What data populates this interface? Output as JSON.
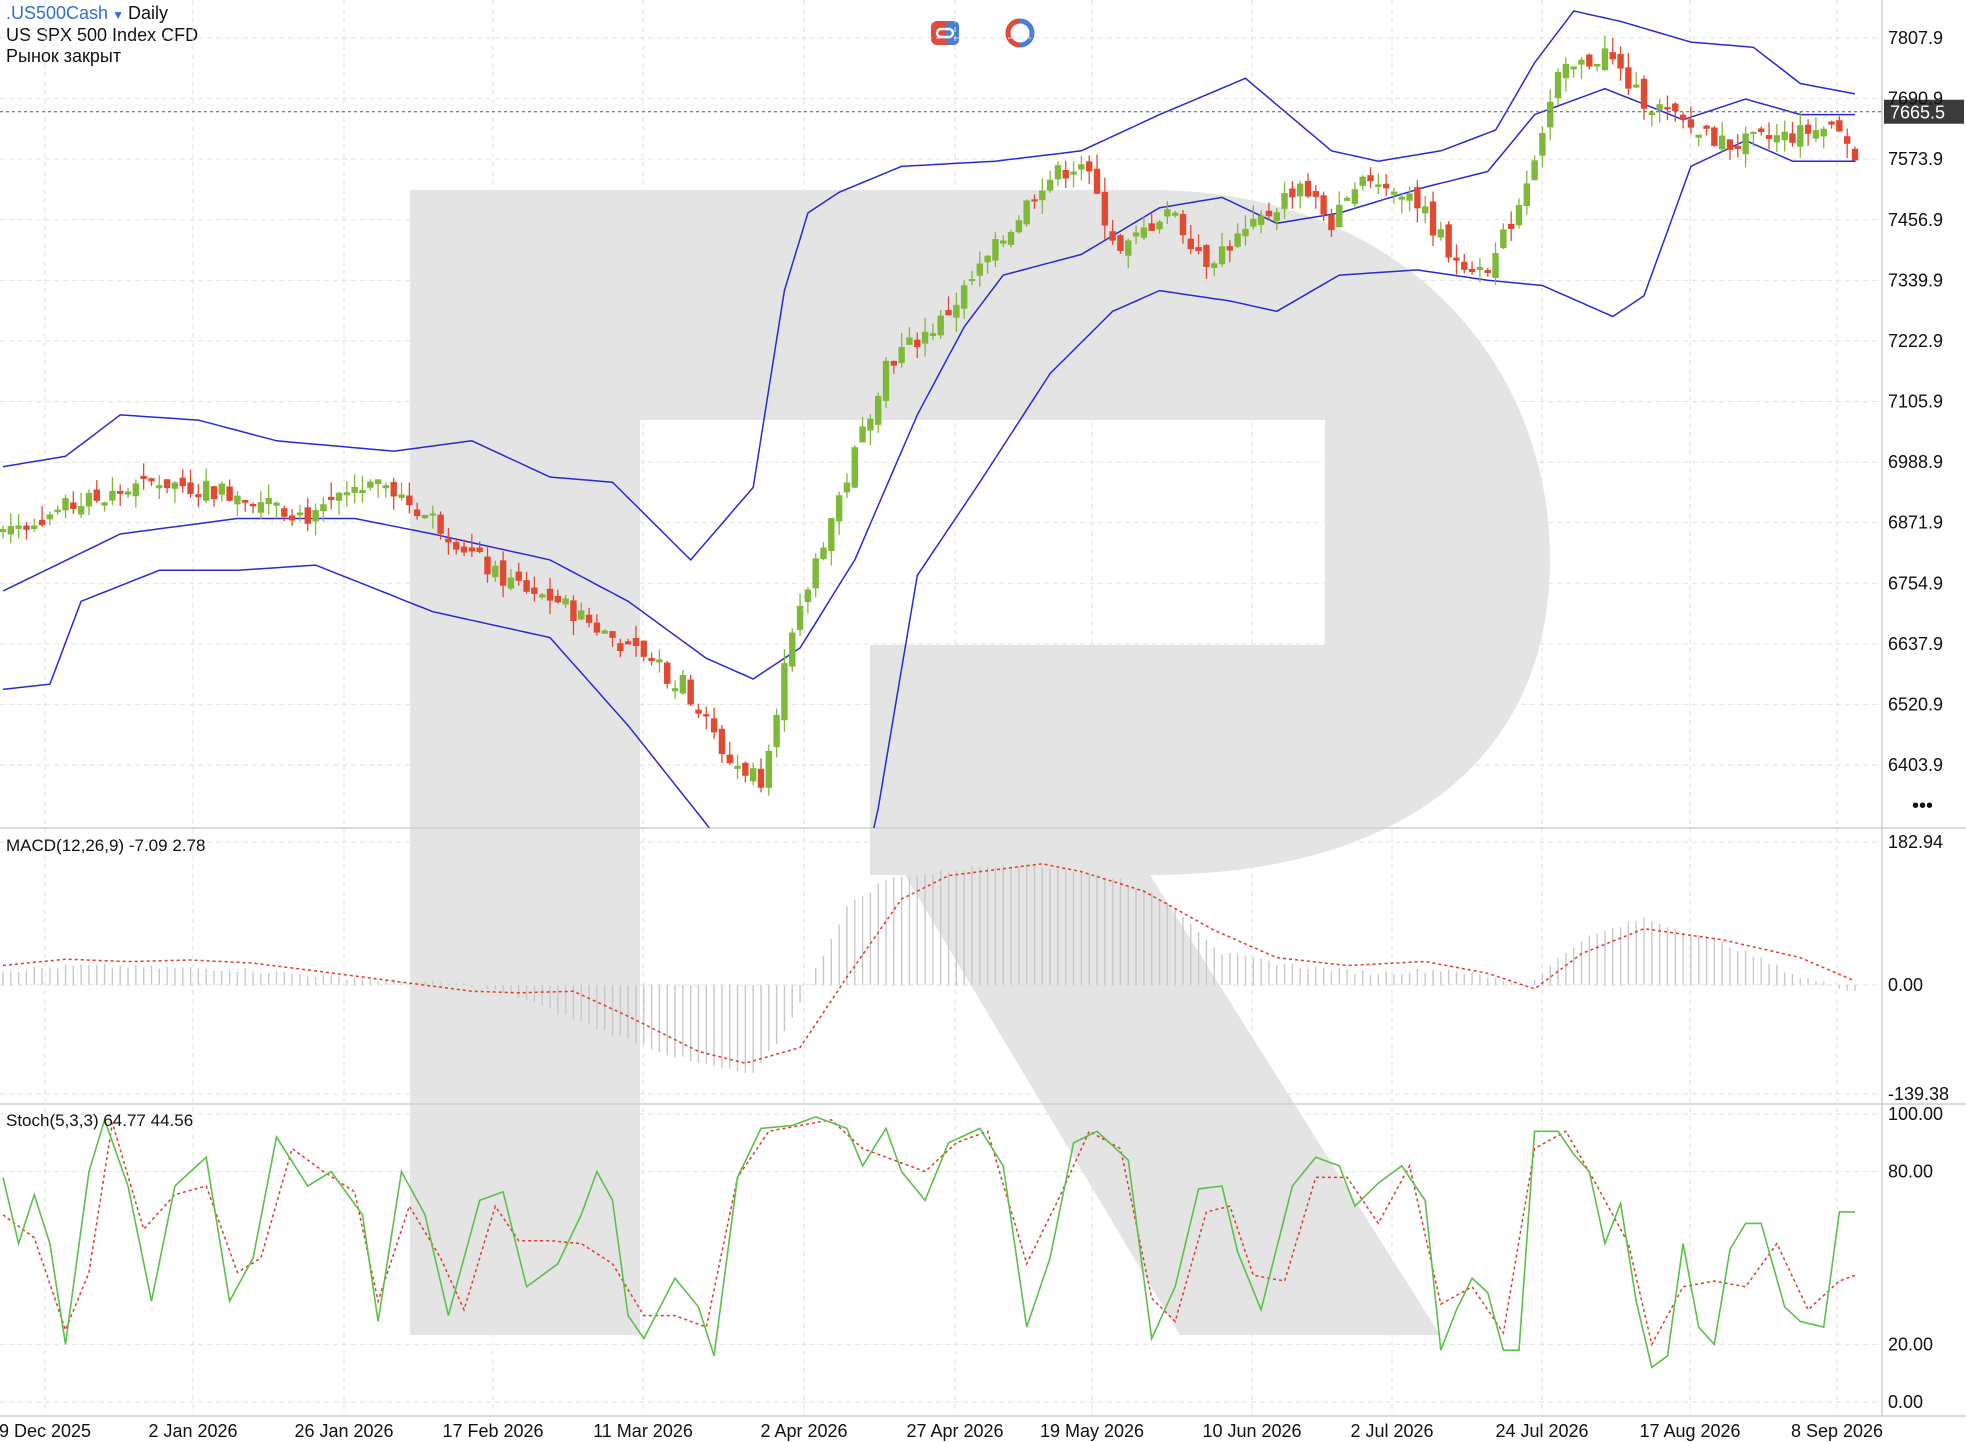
{
  "header": {
    "symbol": ".US500Cash",
    "timeframe": "Daily",
    "instrument": "US SPX 500 Index CFD",
    "market_status": "Рынок закрыт"
  },
  "price_tag": "7665.5",
  "more_label": "•••",
  "colors": {
    "bull": "#7fb93a",
    "bear": "#e04a32",
    "bands": "#2a2ad4",
    "signal": "#e03b2a",
    "stoch_k": "#5cc04a",
    "grid": "#e2e2e2"
  },
  "icons": [
    "link-icon",
    "clock-icon"
  ],
  "chart_data": [
    {
      "type": "candlestick",
      "indicator": "Bollinger Bands",
      "y_ticks": [
        "7807.9",
        "7690.9",
        "7573.9",
        "7456.9",
        "7339.9",
        "7222.9",
        "7105.9",
        "6988.9",
        "6871.9",
        "6754.9",
        "6637.9",
        "6520.9",
        "6403.9"
      ],
      "ylim": [
        6313,
        7812
      ],
      "x_ticks": [
        "9 Dec 2025",
        "2 Jan 2026",
        "26 Jan 2026",
        "17 Feb 2026",
        "11 Mar 2026",
        "2 Apr 2026",
        "27 Apr 2026",
        "19 May 2026",
        "10 Jun 2026",
        "2 Jul 2026",
        "24 Jul 2026",
        "17 Aug 2026",
        "8 Sep 2026"
      ],
      "last_price": 7665.5,
      "close_path": [
        [
          0,
          6860
        ],
        [
          10,
          6910
        ],
        [
          20,
          6950
        ],
        [
          30,
          6930
        ],
        [
          40,
          6880
        ],
        [
          47,
          6965
        ],
        [
          55,
          6880
        ],
        [
          63,
          6770
        ],
        [
          71,
          6720
        ],
        [
          79,
          6640
        ],
        [
          87,
          6560
        ],
        [
          93,
          6410
        ],
        [
          97,
          6380
        ],
        [
          100,
          6590
        ],
        [
          104,
          6800
        ],
        [
          108,
          6960
        ],
        [
          113,
          7180
        ],
        [
          120,
          7260
        ],
        [
          127,
          7400
        ],
        [
          133,
          7530
        ],
        [
          138,
          7570
        ],
        [
          143,
          7390
        ],
        [
          149,
          7480
        ],
        [
          154,
          7380
        ],
        [
          160,
          7440
        ],
        [
          166,
          7530
        ],
        [
          170,
          7450
        ],
        [
          175,
          7540
        ],
        [
          180,
          7510
        ],
        [
          185,
          7400
        ],
        [
          190,
          7350
        ],
        [
          194,
          7490
        ],
        [
          199,
          7730
        ],
        [
          205,
          7780
        ],
        [
          209,
          7700
        ],
        [
          215,
          7640
        ],
        [
          221,
          7600
        ],
        [
          229,
          7620
        ],
        [
          235,
          7640
        ],
        [
          237,
          7580
        ]
      ],
      "bands_upper": [
        [
          0,
          6980
        ],
        [
          8,
          7000
        ],
        [
          15,
          7080
        ],
        [
          25,
          7070
        ],
        [
          35,
          7030
        ],
        [
          50,
          7010
        ],
        [
          60,
          7030
        ],
        [
          70,
          6960
        ],
        [
          78,
          6950
        ],
        [
          88,
          6800
        ],
        [
          96,
          6940
        ],
        [
          100,
          7320
        ],
        [
          103,
          7470
        ],
        [
          107,
          7510
        ],
        [
          115,
          7560
        ],
        [
          127,
          7570
        ],
        [
          138,
          7590
        ],
        [
          148,
          7660
        ],
        [
          159,
          7730
        ],
        [
          170,
          7590
        ],
        [
          176,
          7570
        ],
        [
          184,
          7590
        ],
        [
          191,
          7630
        ],
        [
          196,
          7760
        ],
        [
          201,
          7860
        ],
        [
          207,
          7840
        ],
        [
          216,
          7800
        ],
        [
          224,
          7790
        ],
        [
          230,
          7720
        ],
        [
          237,
          7700
        ]
      ],
      "bands_middle": [
        [
          0,
          6740
        ],
        [
          15,
          6850
        ],
        [
          30,
          6880
        ],
        [
          45,
          6880
        ],
        [
          55,
          6850
        ],
        [
          70,
          6800
        ],
        [
          80,
          6720
        ],
        [
          90,
          6610
        ],
        [
          96,
          6570
        ],
        [
          102,
          6630
        ],
        [
          109,
          6800
        ],
        [
          117,
          7080
        ],
        [
          123,
          7250
        ],
        [
          128,
          7350
        ],
        [
          138,
          7390
        ],
        [
          148,
          7480
        ],
        [
          156,
          7500
        ],
        [
          163,
          7450
        ],
        [
          171,
          7470
        ],
        [
          182,
          7520
        ],
        [
          190,
          7550
        ],
        [
          196,
          7660
        ],
        [
          205,
          7710
        ],
        [
          215,
          7650
        ],
        [
          223,
          7690
        ],
        [
          230,
          7660
        ],
        [
          237,
          7660
        ]
      ],
      "bands_lower": [
        [
          0,
          6550
        ],
        [
          6,
          6560
        ],
        [
          10,
          6720
        ],
        [
          20,
          6780
        ],
        [
          30,
          6780
        ],
        [
          40,
          6790
        ],
        [
          55,
          6700
        ],
        [
          70,
          6650
        ],
        [
          80,
          6480
        ],
        [
          90,
          6290
        ],
        [
          100,
          6070
        ],
        [
          108,
          6050
        ],
        [
          112,
          6320
        ],
        [
          117,
          6770
        ],
        [
          125,
          6950
        ],
        [
          134,
          7160
        ],
        [
          142,
          7280
        ],
        [
          148,
          7320
        ],
        [
          157,
          7300
        ],
        [
          163,
          7280
        ],
        [
          171,
          7350
        ],
        [
          181,
          7360
        ],
        [
          190,
          7340
        ],
        [
          197,
          7330
        ],
        [
          206,
          7270
        ],
        [
          210,
          7310
        ],
        [
          216,
          7560
        ],
        [
          223,
          7610
        ],
        [
          229,
          7570
        ],
        [
          237,
          7570
        ]
      ]
    },
    {
      "type": "bar",
      "name": "MACD(12,26,9)",
      "label_values": "-7.09 2.78",
      "y_ticks": [
        "182.94",
        "0.00",
        "-139.38"
      ],
      "ylim": [
        -139.38,
        182.94
      ],
      "histogram_path": [
        [
          0,
          18
        ],
        [
          10,
          25
        ],
        [
          20,
          22
        ],
        [
          30,
          20
        ],
        [
          40,
          12
        ],
        [
          50,
          5
        ],
        [
          60,
          0
        ],
        [
          66,
          -15
        ],
        [
          72,
          -40
        ],
        [
          80,
          -70
        ],
        [
          88,
          -98
        ],
        [
          96,
          -115
        ],
        [
          100,
          -60
        ],
        [
          104,
          20
        ],
        [
          108,
          100
        ],
        [
          113,
          135
        ],
        [
          120,
          145
        ],
        [
          128,
          155
        ],
        [
          135,
          150
        ],
        [
          143,
          135
        ],
        [
          150,
          100
        ],
        [
          156,
          40
        ],
        [
          165,
          25
        ],
        [
          175,
          15
        ],
        [
          185,
          20
        ],
        [
          195,
          0
        ],
        [
          202,
          58
        ],
        [
          210,
          85
        ],
        [
          220,
          55
        ],
        [
          230,
          10
        ],
        [
          237,
          -7
        ]
      ],
      "signal_path": [
        [
          0,
          25
        ],
        [
          8,
          33
        ],
        [
          16,
          30
        ],
        [
          24,
          32
        ],
        [
          32,
          28
        ],
        [
          40,
          18
        ],
        [
          50,
          5
        ],
        [
          60,
          -8
        ],
        [
          66,
          -10
        ],
        [
          73,
          -8
        ],
        [
          80,
          -40
        ],
        [
          89,
          -85
        ],
        [
          95,
          -100
        ],
        [
          102,
          -80
        ],
        [
          108,
          10
        ],
        [
          115,
          110
        ],
        [
          121,
          140
        ],
        [
          133,
          155
        ],
        [
          138,
          145
        ],
        [
          146,
          120
        ],
        [
          155,
          70
        ],
        [
          163,
          35
        ],
        [
          172,
          25
        ],
        [
          182,
          30
        ],
        [
          190,
          15
        ],
        [
          196,
          -5
        ],
        [
          202,
          40
        ],
        [
          210,
          72
        ],
        [
          220,
          58
        ],
        [
          230,
          35
        ],
        [
          237,
          5
        ]
      ]
    },
    {
      "type": "line",
      "name": "Stoch(5,3,3)",
      "label_values": "64.77 44.56",
      "y_ticks": [
        "100.00",
        "80.00",
        "20.00",
        "0.00"
      ],
      "ylim": [
        0,
        100
      ],
      "k_path": [
        [
          0,
          78
        ],
        [
          2,
          55
        ],
        [
          4,
          72
        ],
        [
          6,
          55
        ],
        [
          8,
          20
        ],
        [
          11,
          80
        ],
        [
          13,
          98
        ],
        [
          16,
          75
        ],
        [
          19,
          35
        ],
        [
          22,
          75
        ],
        [
          26,
          85
        ],
        [
          29,
          35
        ],
        [
          32,
          50
        ],
        [
          35,
          92
        ],
        [
          39,
          75
        ],
        [
          42,
          80
        ],
        [
          46,
          65
        ],
        [
          48,
          28
        ],
        [
          51,
          80
        ],
        [
          54,
          65
        ],
        [
          57,
          30
        ],
        [
          61,
          70
        ],
        [
          64,
          73
        ],
        [
          67,
          40
        ],
        [
          71,
          48
        ],
        [
          74,
          65
        ],
        [
          76,
          80
        ],
        [
          78,
          70
        ],
        [
          80,
          30
        ],
        [
          82,
          22
        ],
        [
          86,
          43
        ],
        [
          89,
          33
        ],
        [
          91,
          16
        ],
        [
          94,
          78
        ],
        [
          97,
          95
        ],
        [
          101,
          96
        ],
        [
          104,
          99
        ],
        [
          108,
          95
        ],
        [
          110,
          82
        ],
        [
          113,
          95
        ],
        [
          115,
          80
        ],
        [
          118,
          70
        ],
        [
          121,
          90
        ],
        [
          125,
          95
        ],
        [
          128,
          82
        ],
        [
          131,
          26
        ],
        [
          134,
          50
        ],
        [
          137,
          90
        ],
        [
          140,
          94
        ],
        [
          144,
          84
        ],
        [
          147,
          22
        ],
        [
          150,
          40
        ],
        [
          153,
          74
        ],
        [
          156,
          75
        ],
        [
          158,
          52
        ],
        [
          161,
          32
        ],
        [
          165,
          75
        ],
        [
          168,
          85
        ],
        [
          171,
          82
        ],
        [
          173,
          68
        ],
        [
          176,
          76
        ],
        [
          179,
          82
        ],
        [
          182,
          70
        ],
        [
          184,
          18
        ],
        [
          186,
          32
        ],
        [
          188,
          43
        ],
        [
          190,
          38
        ],
        [
          192,
          18
        ],
        [
          194,
          18
        ],
        [
          196,
          94
        ],
        [
          199,
          94
        ],
        [
          201,
          86
        ],
        [
          203,
          80
        ],
        [
          205,
          55
        ],
        [
          207,
          69
        ],
        [
          209,
          35
        ],
        [
          211,
          12
        ],
        [
          213,
          16
        ],
        [
          215,
          55
        ],
        [
          217,
          26
        ],
        [
          219,
          20
        ],
        [
          221,
          53
        ],
        [
          223,
          62
        ],
        [
          225,
          62
        ],
        [
          228,
          33
        ],
        [
          230,
          28
        ],
        [
          233,
          26
        ],
        [
          235,
          66
        ],
        [
          237,
          66
        ]
      ],
      "d_path": [
        [
          0,
          65
        ],
        [
          4,
          57
        ],
        [
          8,
          25
        ],
        [
          11,
          45
        ],
        [
          14,
          97
        ],
        [
          18,
          60
        ],
        [
          22,
          72
        ],
        [
          26,
          75
        ],
        [
          30,
          45
        ],
        [
          33,
          50
        ],
        [
          37,
          88
        ],
        [
          41,
          80
        ],
        [
          45,
          73
        ],
        [
          48,
          35
        ],
        [
          52,
          68
        ],
        [
          56,
          50
        ],
        [
          59,
          32
        ],
        [
          63,
          68
        ],
        [
          66,
          56
        ],
        [
          70,
          56
        ],
        [
          74,
          55
        ],
        [
          78,
          48
        ],
        [
          82,
          30
        ],
        [
          86,
          30
        ],
        [
          90,
          26
        ],
        [
          94,
          78
        ],
        [
          98,
          94
        ],
        [
          102,
          96
        ],
        [
          106,
          98
        ],
        [
          110,
          88
        ],
        [
          114,
          84
        ],
        [
          118,
          80
        ],
        [
          122,
          90
        ],
        [
          126,
          94
        ],
        [
          131,
          48
        ],
        [
          135,
          70
        ],
        [
          139,
          94
        ],
        [
          143,
          88
        ],
        [
          147,
          36
        ],
        [
          150,
          28
        ],
        [
          154,
          66
        ],
        [
          157,
          68
        ],
        [
          160,
          44
        ],
        [
          164,
          42
        ],
        [
          168,
          78
        ],
        [
          172,
          78
        ],
        [
          176,
          62
        ],
        [
          180,
          82
        ],
        [
          184,
          34
        ],
        [
          188,
          40
        ],
        [
          192,
          24
        ],
        [
          196,
          88
        ],
        [
          200,
          94
        ],
        [
          204,
          75
        ],
        [
          208,
          55
        ],
        [
          211,
          20
        ],
        [
          215,
          40
        ],
        [
          219,
          42
        ],
        [
          223,
          40
        ],
        [
          227,
          55
        ],
        [
          231,
          32
        ],
        [
          235,
          42
        ],
        [
          237,
          44
        ]
      ]
    }
  ]
}
